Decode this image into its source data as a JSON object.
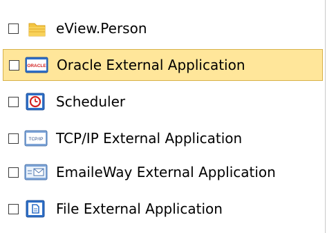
{
  "tree": {
    "items": [
      {
        "label": "eView.Person",
        "icon": "folder-icon",
        "selected": false,
        "checked": false
      },
      {
        "label": "Oracle External Application",
        "icon": "oracle-app-icon",
        "selected": true,
        "checked": false
      },
      {
        "label": "Scheduler",
        "icon": "scheduler-icon",
        "selected": false,
        "checked": false
      },
      {
        "label": "TCP/IP External Application",
        "icon": "tcpip-app-icon",
        "selected": false,
        "checked": false
      },
      {
        "label": "EmaileWay External Application",
        "icon": "email-app-icon",
        "selected": false,
        "checked": false
      },
      {
        "label": "File External Application",
        "icon": "file-app-icon",
        "selected": false,
        "checked": false
      }
    ],
    "icon_badges": {
      "oracle": "ORACLE",
      "tcpip": "TCP/IP"
    }
  },
  "colors": {
    "selection_bg": "#ffe69a",
    "selection_border": "#d7b14a",
    "icon_blue": "#2e6fc7",
    "icon_red": "#d22020",
    "folder_yellow": "#f4c542"
  }
}
